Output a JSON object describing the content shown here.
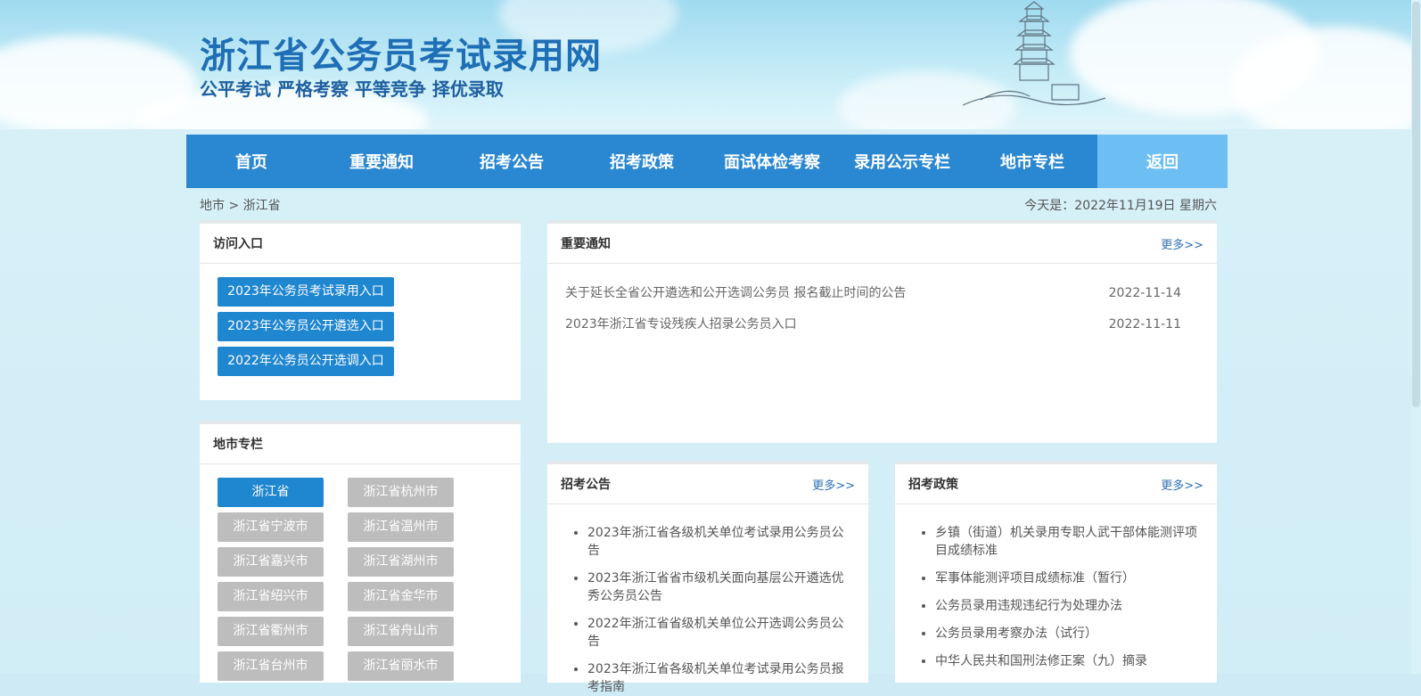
{
  "header": {
    "title": "浙江省公务员考试录用网",
    "slogan": "公平考试 严格考察 平等竞争 择优录取"
  },
  "nav": {
    "items": [
      {
        "label": "首页"
      },
      {
        "label": "重要通知"
      },
      {
        "label": "招考公告"
      },
      {
        "label": "招考政策"
      },
      {
        "label": "面试体检考察"
      },
      {
        "label": "录用公示专栏"
      },
      {
        "label": "地市专栏"
      },
      {
        "label": "返回"
      }
    ]
  },
  "breadcrumb": "地市 > 浙江省",
  "today": "今天是：2022年11月19日 星期六",
  "access": {
    "title": "访问入口",
    "buttons": [
      {
        "label": "2023年公务员考试录用入口"
      },
      {
        "label": "2023年公务员公开遴选入口"
      },
      {
        "label": "2022年公务员公开选调入口"
      }
    ]
  },
  "cities": {
    "title": "地市专栏",
    "items": [
      {
        "label": "浙江省"
      },
      {
        "label": "浙江省杭州市"
      },
      {
        "label": "浙江省宁波市"
      },
      {
        "label": "浙江省温州市"
      },
      {
        "label": "浙江省嘉兴市"
      },
      {
        "label": "浙江省湖州市"
      },
      {
        "label": "浙江省绍兴市"
      },
      {
        "label": "浙江省金华市"
      },
      {
        "label": "浙江省衢州市"
      },
      {
        "label": "浙江省舟山市"
      },
      {
        "label": "浙江省台州市"
      },
      {
        "label": "浙江省丽水市"
      }
    ]
  },
  "notices": {
    "title": "重要通知",
    "more": "更多>>",
    "items": [
      {
        "text": "关于延长全省公开遴选和公开选调公务员 报名截止时间的公告",
        "date": "2022-11-14"
      },
      {
        "text": "2023年浙江省专设残疾人招录公务员入口",
        "date": "2022-11-11"
      }
    ]
  },
  "recruit": {
    "title": "招考公告",
    "more": "更多>>",
    "items": [
      "2023年浙江省各级机关单位考试录用公务员公告",
      "2023年浙江省省市级机关面向基层公开遴选优秀公务员公告",
      "2022年浙江省省级机关单位公开选调公务员公告",
      "2023年浙江省各级机关单位考试录用公务员报考指南"
    ]
  },
  "policy": {
    "title": "招考政策",
    "more": "更多>>",
    "items": [
      "乡镇（街道）机关录用专职人武干部体能测评项目成绩标准",
      "军事体能测评项目成绩标准（暂行）",
      "公务员录用违规违纪行为处理办法",
      "公务员录用考察办法（试行）",
      "中华人民共和国刑法修正案（九）摘录"
    ]
  }
}
